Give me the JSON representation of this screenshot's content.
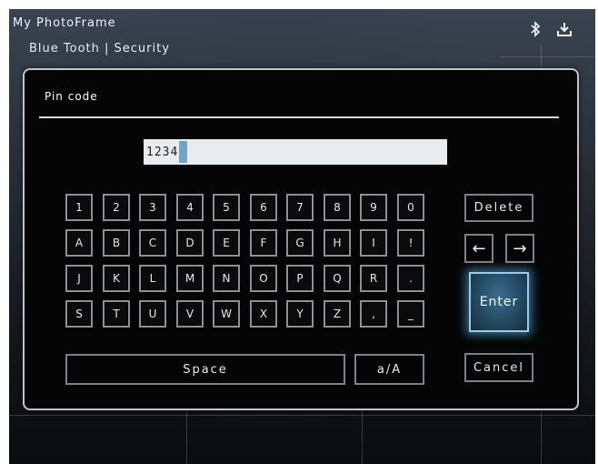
{
  "header": {
    "app_title": "My PhotoFrame",
    "breadcrumb": "Blue Tooth | Security",
    "icons": [
      "bluetooth-icon",
      "download-icon"
    ]
  },
  "dialog": {
    "title": "Pin code",
    "pin_value": "1234"
  },
  "keyboard": {
    "rows": [
      [
        "1",
        "2",
        "3",
        "4",
        "5",
        "6",
        "7",
        "8",
        "9",
        "0"
      ],
      [
        "A",
        "B",
        "C",
        "D",
        "E",
        "F",
        "G",
        "H",
        "I",
        "!"
      ],
      [
        "J",
        "K",
        "L",
        "M",
        "N",
        "O",
        "P",
        "Q",
        "R",
        "."
      ],
      [
        "S",
        "T",
        "U",
        "V",
        "W",
        "X",
        "Y",
        "Z",
        ",",
        "_"
      ]
    ],
    "space_label": "Space",
    "case_label": "a/A",
    "delete_label": "Delete",
    "enter_label": "Enter",
    "cancel_label": "Cancel",
    "left_arrow": "←",
    "right_arrow": "→"
  },
  "colors": {
    "enter_accent": "#3d6e8f",
    "cursor": "#6fa4c9"
  }
}
